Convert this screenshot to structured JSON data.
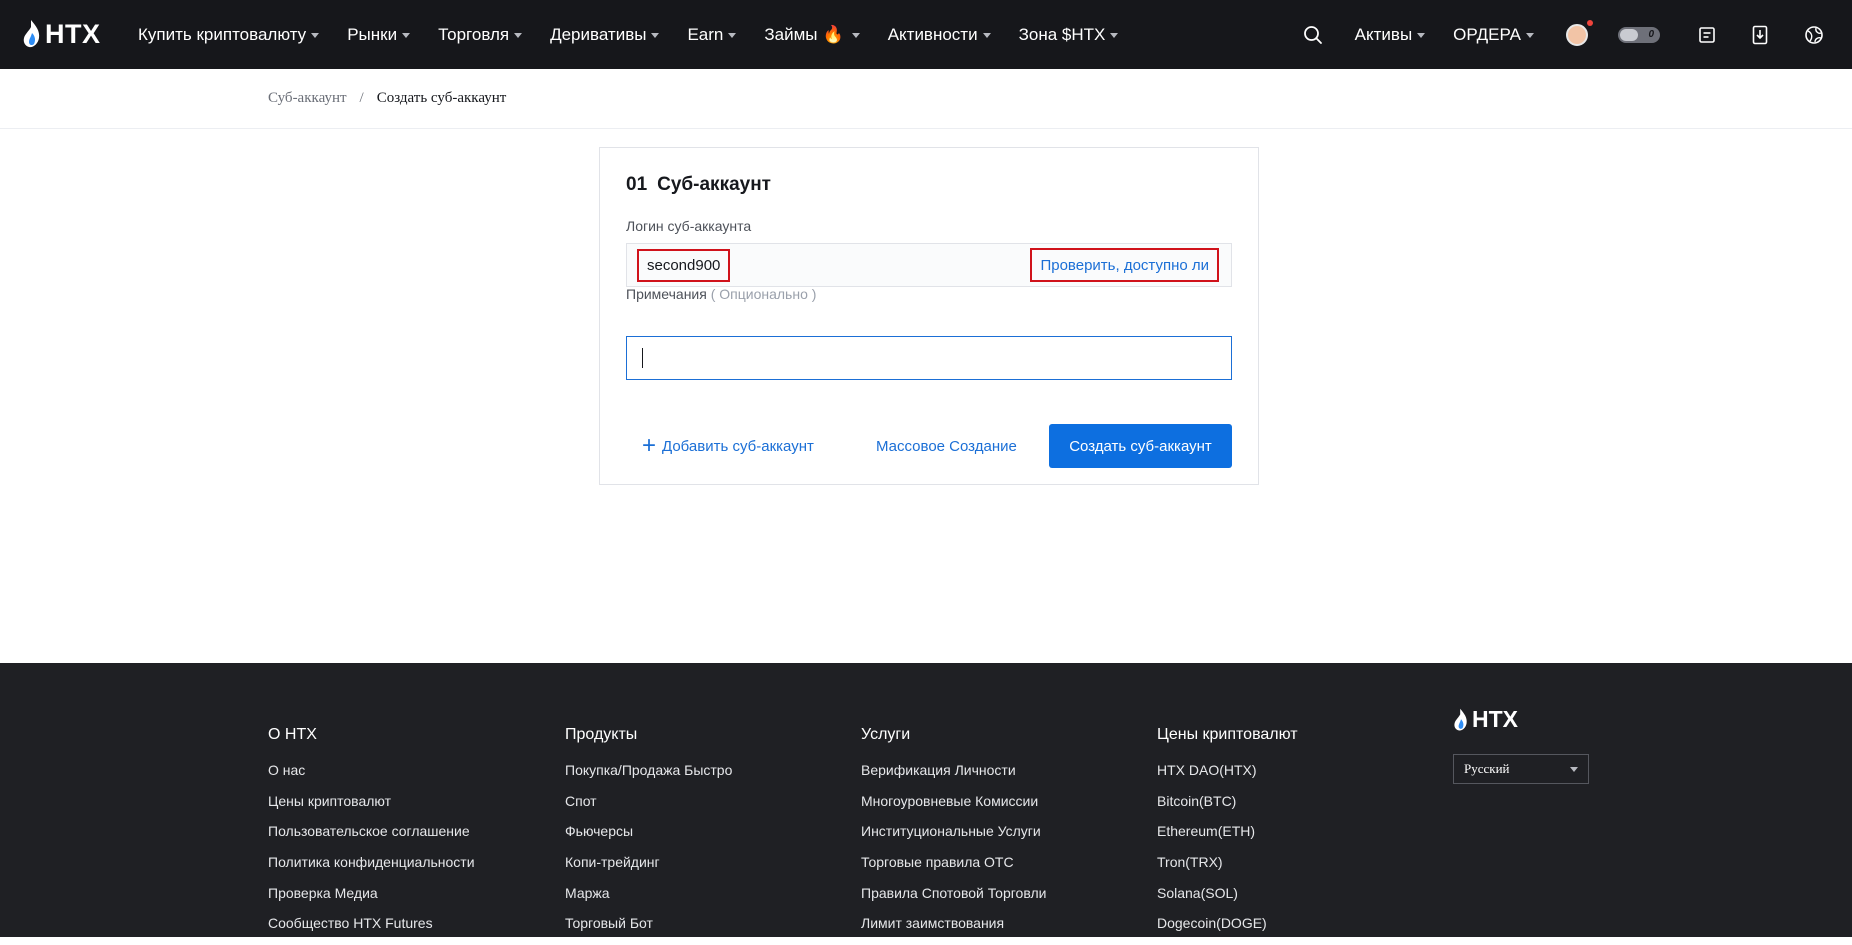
{
  "brand": {
    "name": "HTX"
  },
  "nav": {
    "items": [
      {
        "label": "Купить криптовалюту",
        "caret": true
      },
      {
        "label": "Рынки",
        "caret": true
      },
      {
        "label": "Торговля",
        "caret": true
      },
      {
        "label": "Деривативы",
        "caret": true
      },
      {
        "label": "Earn",
        "caret": true
      },
      {
        "label": "Займы",
        "caret": true,
        "icon": "fire-icon"
      },
      {
        "label": "Активности",
        "caret": true
      },
      {
        "label": "Зона $HTX",
        "caret": true
      }
    ],
    "right": {
      "assets_label": "Активы",
      "orders_label": "ОРДЕРА",
      "toggle_value": "0",
      "icons": [
        "search-icon",
        "avatar",
        "toggle",
        "orders-doc-icon",
        "download-icon",
        "globe-icon"
      ]
    }
  },
  "breadcrumb": {
    "parent": "Суб-аккаунт",
    "separator": "/",
    "current": "Создать суб-аккаунт"
  },
  "form": {
    "step_number": "01",
    "title": "Суб-аккаунт",
    "login_label": "Логин суб-аккаунта",
    "login_value": "second900",
    "check_button": "Проверить, доступно ли",
    "notes_label": "Примечания",
    "notes_optional": "( Опционально )",
    "notes_value": "",
    "add_button": "Добавить суб-аккаунт",
    "bulk_button": "Массовое Создание",
    "create_button": "Создать суб-аккаунт"
  },
  "footer": {
    "columns": [
      {
        "title": "О HTX",
        "links": [
          "О нас",
          "Цены криптовалют",
          "Пользовательское соглашение",
          "Политика конфиденциальности",
          "Проверка Медиа",
          "Сообщество HTX Futures"
        ]
      },
      {
        "title": "Продукты",
        "links": [
          "Покупка/Продажа Быстро",
          "Спот",
          "Фьючерсы",
          "Копи-трейдинг",
          "Маржа",
          "Торговый Бот"
        ]
      },
      {
        "title": "Услуги",
        "links": [
          "Верификация Личности",
          "Многоуровневые Комиссии",
          "Институциональные Услуги",
          "Торговые правила OTC",
          "Правила Спотовой Торговли",
          "Лимит заимствования"
        ]
      },
      {
        "title": "Цены криптовалют",
        "links": [
          "HTX DAO(HTX)",
          "Bitcoin(BTC)",
          "Ethereum(ETH)",
          "Tron(TRX)",
          "Solana(SOL)",
          "Dogecoin(DOGE)"
        ]
      }
    ],
    "language": "Русский"
  },
  "colors": {
    "nav_bg": "#16171b",
    "accent": "#0d6fe0",
    "link": "#1b6fd6",
    "highlight_border": "#d0121b",
    "footer_bg": "#1f2024"
  }
}
